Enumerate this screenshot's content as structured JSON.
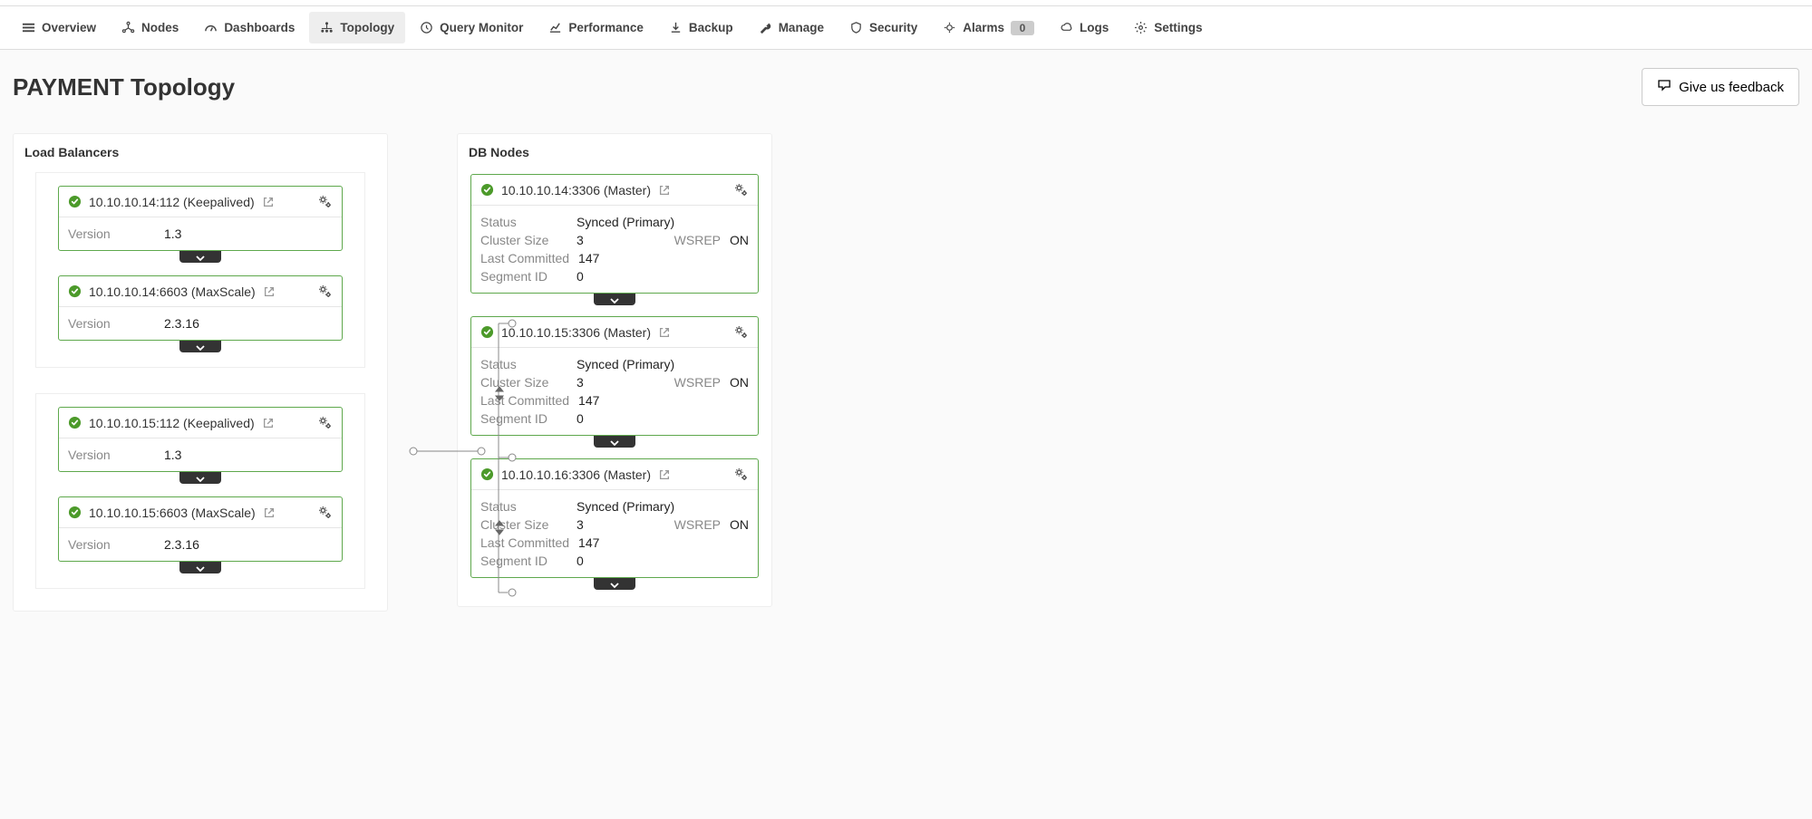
{
  "nav": {
    "items": [
      {
        "label": "Overview"
      },
      {
        "label": "Nodes"
      },
      {
        "label": "Dashboards"
      },
      {
        "label": "Topology"
      },
      {
        "label": "Query Monitor"
      },
      {
        "label": "Performance"
      },
      {
        "label": "Backup"
      },
      {
        "label": "Manage"
      },
      {
        "label": "Security"
      },
      {
        "label": "Alarms",
        "badge": "0"
      },
      {
        "label": "Logs"
      },
      {
        "label": "Settings"
      }
    ],
    "active_index": 3
  },
  "page": {
    "title": "PAYMENT Topology",
    "feedback_label": "Give us feedback"
  },
  "load_balancers": {
    "title": "Load Balancers",
    "groups": [
      {
        "nodes": [
          {
            "title": "10.10.10.14:112 (Keepalived)",
            "version_label": "Version",
            "version": "1.3"
          },
          {
            "title": "10.10.10.14:6603 (MaxScale)",
            "version_label": "Version",
            "version": "2.3.16"
          }
        ]
      },
      {
        "nodes": [
          {
            "title": "10.10.10.15:112 (Keepalived)",
            "version_label": "Version",
            "version": "1.3"
          },
          {
            "title": "10.10.10.15:6603 (MaxScale)",
            "version_label": "Version",
            "version": "2.3.16"
          }
        ]
      }
    ]
  },
  "db_nodes": {
    "title": "DB Nodes",
    "labels": {
      "status": "Status",
      "cluster_size": "Cluster Size",
      "wsrep": "WSREP",
      "last_committed": "Last Committed",
      "segment_id": "Segment ID"
    },
    "nodes": [
      {
        "title": "10.10.10.14:3306 (Master)",
        "status": "Synced (Primary)",
        "cluster_size": "3",
        "wsrep": "ON",
        "last_committed": "147",
        "segment_id": "0"
      },
      {
        "title": "10.10.10.15:3306 (Master)",
        "status": "Synced (Primary)",
        "cluster_size": "3",
        "wsrep": "ON",
        "last_committed": "147",
        "segment_id": "0"
      },
      {
        "title": "10.10.10.16:3306 (Master)",
        "status": "Synced (Primary)",
        "cluster_size": "3",
        "wsrep": "ON",
        "last_committed": "147",
        "segment_id": "0"
      }
    ]
  }
}
